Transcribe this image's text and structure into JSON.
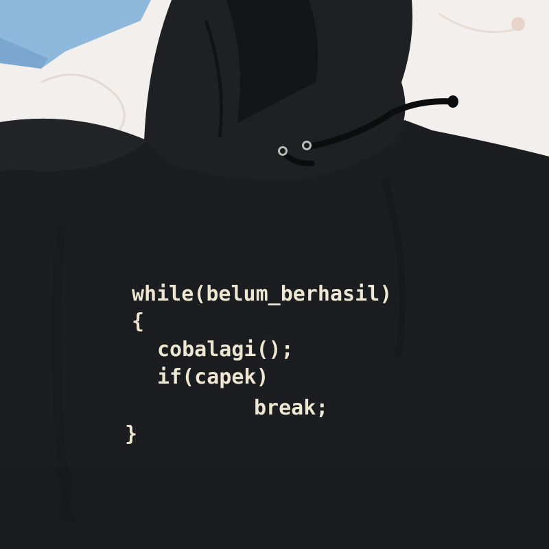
{
  "scene": {
    "subject": "black-hoodie",
    "colors": {
      "background": "#f3efec",
      "fabric_light": "#f4f0ee",
      "blue_cloth": "#8fb8dd",
      "hoodie": "#1b1d20",
      "hoodie_shadow": "#111214",
      "drawstring": "#0c0d0f",
      "grommet": "#b8b8b8",
      "print_text": "#ede6d3"
    }
  },
  "print": {
    "lines": [
      "while(belum_berhasil)",
      "{",
      "cobalagi();",
      "if(capek)",
      "break;",
      "}"
    ]
  }
}
